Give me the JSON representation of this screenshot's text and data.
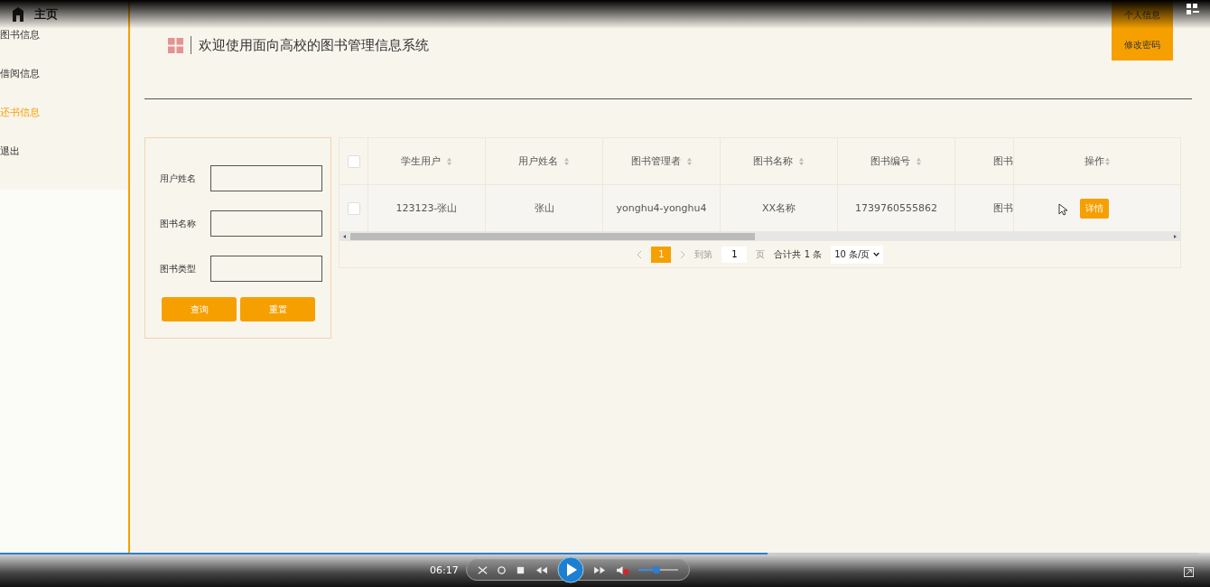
{
  "sidebar": {
    "home": "主页",
    "items": [
      {
        "label": "图书信息",
        "selected": false
      },
      {
        "label": "借阅信息",
        "selected": false
      },
      {
        "label": "还书信息",
        "selected": true
      },
      {
        "label": "退出",
        "selected": false
      }
    ]
  },
  "header": {
    "title": "欢迎使用面向高校的图书管理信息系统",
    "menu": [
      "个人信息",
      "修改密码"
    ]
  },
  "search": {
    "fields": [
      {
        "label": "用户姓名"
      },
      {
        "label": "图书名称"
      },
      {
        "label": "图书类型"
      }
    ],
    "buttons": [
      "查询",
      "重置"
    ]
  },
  "table": {
    "columns": [
      "学生用户",
      "用户姓名",
      "图书管理者",
      "图书名称",
      "图书编号",
      "图书"
    ],
    "action_column": "操作",
    "rows": [
      {
        "checked": false,
        "cells": [
          "123123-张山",
          "张山",
          "yonghu4-yonghu4",
          "XX名称",
          "1739760555862",
          "图书"
        ],
        "action": "详情"
      }
    ],
    "header_checked": false
  },
  "pagination": {
    "pages": [
      {
        "label": "1",
        "selected": true
      }
    ],
    "goto_label": "到第",
    "goto_value": "1",
    "page_unit": "页",
    "total": "合计共 1 条",
    "page_size": "10 条/页"
  },
  "player": {
    "time": "06:17",
    "progress": {
      "level": 0.64
    },
    "muted": true,
    "volume": {
      "level": 0.45
    }
  }
}
